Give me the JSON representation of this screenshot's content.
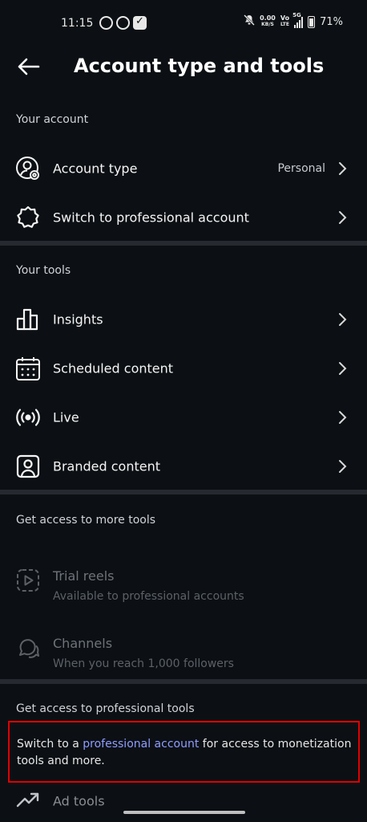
{
  "status_bar": {
    "time": "11:15",
    "net_speed_value": "0.00",
    "net_speed_unit": "KB/S",
    "volte_top": "Vo",
    "volte_bottom": "LTE",
    "network": "5G",
    "battery": "71%",
    "icons": [
      "whatsapp-icon",
      "whatsapp-icon",
      "vpn-check-icon",
      "mute-icon",
      "signal-icon",
      "battery-icon"
    ]
  },
  "header": {
    "title": "Account type and tools",
    "back_icon": "arrow-left-icon"
  },
  "sections": {
    "your_account": {
      "label": "Your account",
      "items": [
        {
          "label": "Account type",
          "value": "Personal",
          "icon": "account-settings-icon"
        },
        {
          "label": "Switch to professional account",
          "icon": "gear-badge-icon"
        }
      ]
    },
    "your_tools": {
      "label": "Your tools",
      "items": [
        {
          "label": "Insights",
          "icon": "bar-chart-icon"
        },
        {
          "label": "Scheduled content",
          "icon": "calendar-icon"
        },
        {
          "label": "Live",
          "icon": "live-broadcast-icon"
        },
        {
          "label": "Branded content",
          "icon": "branded-content-icon"
        }
      ]
    },
    "more_tools": {
      "label": "Get access to more tools",
      "items": [
        {
          "label": "Trial reels",
          "sublabel": "Available to professional accounts",
          "icon": "trial-reels-icon"
        },
        {
          "label": "Channels",
          "sublabel": "When you reach 1,000 followers",
          "icon": "channels-icon"
        }
      ]
    },
    "professional_tools": {
      "label": "Get access to professional tools",
      "promo_prefix": "Switch to a ",
      "promo_link": "professional account",
      "promo_suffix": " for access to monetization tools and more.",
      "items": [
        {
          "label": "Ad tools",
          "icon": "trending-up-icon"
        }
      ]
    }
  },
  "colors": {
    "background": "#0c1014",
    "divider": "#262a30",
    "link": "#8e9dff",
    "highlight_border": "#e00000"
  }
}
